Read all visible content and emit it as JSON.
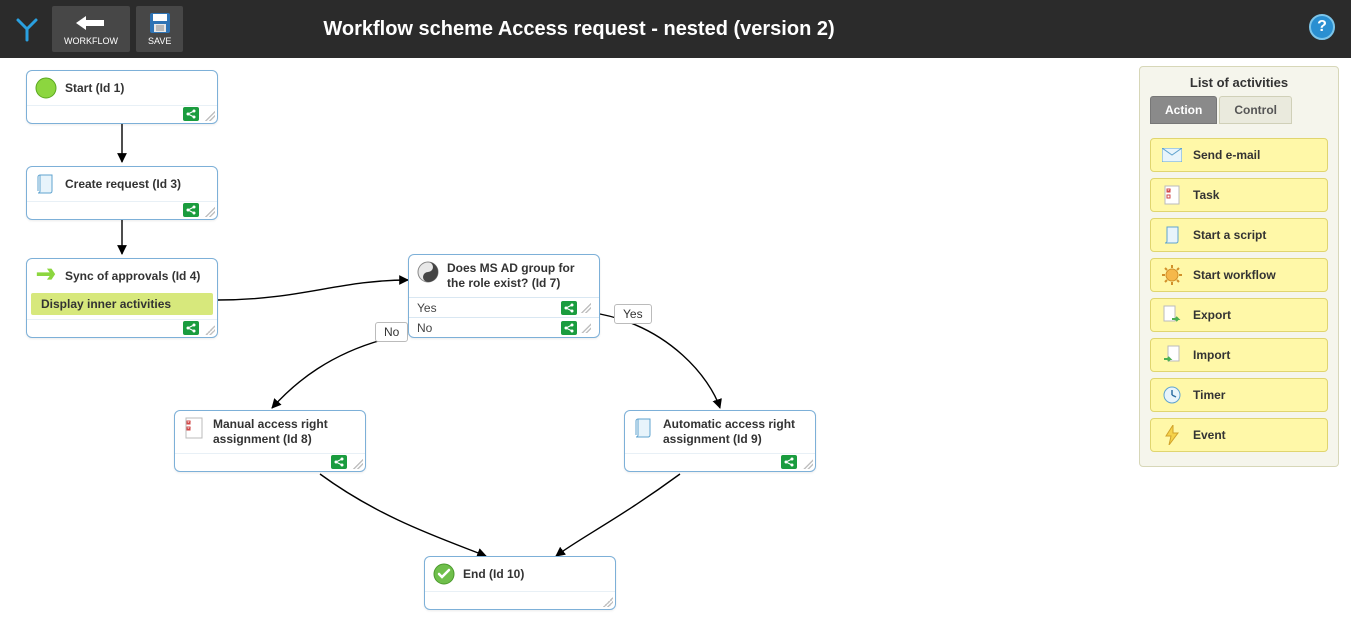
{
  "toolbar": {
    "workflow_label": "WORKFLOW",
    "save_label": "SAVE",
    "title": "Workflow scheme Access request - nested (version 2)"
  },
  "sidebar": {
    "title": "List of activities",
    "tabs": {
      "action": "Action",
      "control": "Control"
    },
    "items": [
      {
        "label": "Send e-mail",
        "icon": "mail"
      },
      {
        "label": "Task",
        "icon": "task"
      },
      {
        "label": "Start a script",
        "icon": "script"
      },
      {
        "label": "Start workflow",
        "icon": "gear-sun"
      },
      {
        "label": "Export",
        "icon": "export"
      },
      {
        "label": "Import",
        "icon": "import"
      },
      {
        "label": "Timer",
        "icon": "clock"
      },
      {
        "label": "Event",
        "icon": "bolt"
      }
    ]
  },
  "nodes": {
    "start": {
      "label": "Start (Id 1)"
    },
    "create_request": {
      "label": "Create request (Id 3)"
    },
    "sync": {
      "label": "Sync of approvals (Id 4)",
      "sub": "Display inner activities"
    },
    "decision": {
      "label": "Does MS AD group for the role exist? (Id 7)",
      "branch_yes": "Yes",
      "branch_no": "No"
    },
    "manual": {
      "label": "Manual access right assignment (Id 8)"
    },
    "auto": {
      "label": "Automatic access right assignment (Id 9)"
    },
    "end": {
      "label": "End (Id 10)"
    }
  },
  "edge_labels": {
    "yes": "Yes",
    "no": "No"
  }
}
